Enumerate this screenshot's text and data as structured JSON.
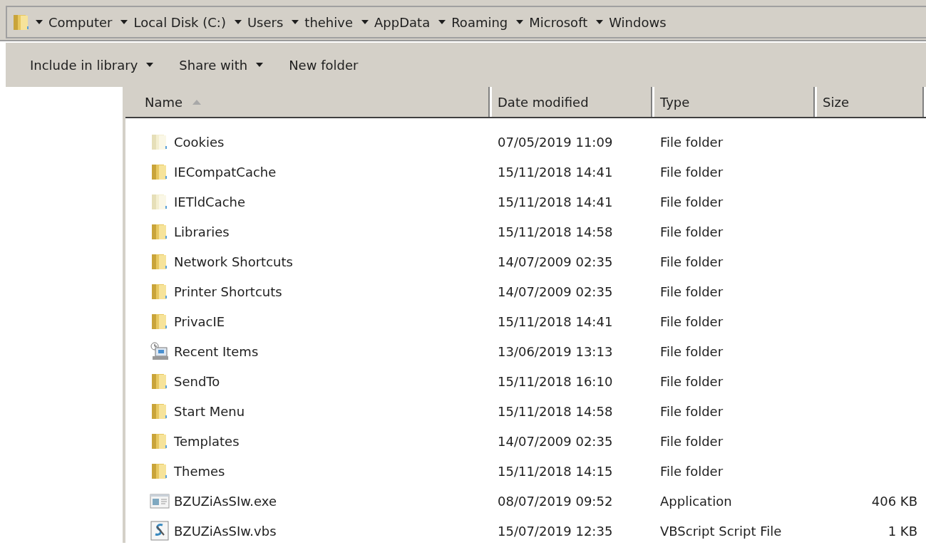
{
  "address_bar": {
    "crumbs": [
      "Computer",
      "Local Disk (C:)",
      "Users",
      "thehive",
      "AppData",
      "Roaming",
      "Microsoft",
      "Windows"
    ]
  },
  "toolbar": {
    "buttons": [
      {
        "label": "Include in library",
        "dropdown": true
      },
      {
        "label": "Share with",
        "dropdown": true
      },
      {
        "label": "New folder",
        "dropdown": false
      }
    ]
  },
  "table": {
    "columns": [
      {
        "label": "Name",
        "sorted": true
      },
      {
        "label": "Date modified",
        "sorted": false
      },
      {
        "label": "Type",
        "sorted": false
      },
      {
        "label": "Size",
        "sorted": false
      }
    ],
    "rows": [
      {
        "kind": "folder",
        "hidden": true,
        "name": "Cookies",
        "date": "07/05/2019 11:09",
        "type": "File folder"
      },
      {
        "kind": "folder",
        "hidden": false,
        "name": "IECompatCache",
        "date": "15/11/2018 14:41",
        "type": "File folder"
      },
      {
        "kind": "folder",
        "hidden": true,
        "name": "IETldCache",
        "date": "15/11/2018 14:41",
        "type": "File folder"
      },
      {
        "kind": "folder",
        "hidden": false,
        "name": "Libraries",
        "date": "15/11/2018 14:58",
        "type": "File folder"
      },
      {
        "kind": "folder",
        "hidden": false,
        "name": "Network Shortcuts",
        "date": "14/07/2009 02:35",
        "type": "File folder"
      },
      {
        "kind": "folder",
        "hidden": false,
        "name": "Printer Shortcuts",
        "date": "14/07/2009 02:35",
        "type": "File folder"
      },
      {
        "kind": "folder",
        "hidden": false,
        "name": "PrivacIE",
        "date": "15/11/2018 14:41",
        "type": "File folder"
      },
      {
        "kind": "recent",
        "name": "Recent Items",
        "date": "13/06/2019 13:13",
        "type": "File folder"
      },
      {
        "kind": "folder",
        "hidden": false,
        "name": "SendTo",
        "date": "15/11/2018 16:10",
        "type": "File folder"
      },
      {
        "kind": "folder",
        "hidden": false,
        "name": "Start Menu",
        "date": "15/11/2018 14:58",
        "type": "File folder"
      },
      {
        "kind": "folder",
        "hidden": false,
        "name": "Templates",
        "date": "14/07/2009 02:35",
        "type": "File folder"
      },
      {
        "kind": "folder",
        "hidden": false,
        "name": "Themes",
        "date": "15/11/2018 14:15",
        "type": "File folder"
      },
      {
        "kind": "exe",
        "name": "BZUZiAsSIw.exe",
        "date": "08/07/2019 09:52",
        "type": "Application",
        "size": "406 KB"
      },
      {
        "kind": "script",
        "name": "BZUZiAsSIw.vbs",
        "date": "15/07/2019 12:35",
        "type": "VBScript Script File",
        "size": "1 KB"
      }
    ]
  }
}
